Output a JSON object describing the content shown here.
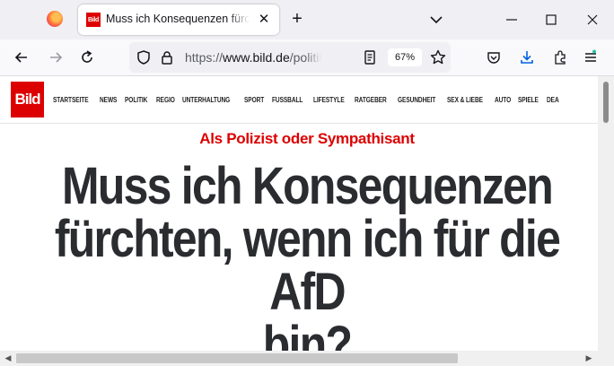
{
  "browser": {
    "tab": {
      "favicon_text": "Bild",
      "title": "Muss ich Konsequenzen fürchten, wenn ich für die AfD bin?"
    },
    "url": {
      "scheme": "https://",
      "host": "www.bild.de",
      "path": "/politik/inland/"
    },
    "zoom": "67%",
    "icons": [
      "firefox-icon",
      "new-tab-icon",
      "tabs-list-icon",
      "minimize-icon",
      "maximize-icon",
      "close-icon",
      "back-icon",
      "forward-icon",
      "reload-icon",
      "shield-icon",
      "lock-icon",
      "reader-view-icon",
      "bookmark-star-icon",
      "pocket-icon",
      "download-icon",
      "extensions-icon",
      "menu-icon"
    ]
  },
  "site": {
    "logo": "Bild",
    "brand_color": "#dd0000",
    "nav": [
      "STARTSEITE",
      "NEWS",
      "POLITIK",
      "REGIO",
      "UNTERHALTUNG",
      "SPORT",
      "FUSSBALL",
      "LIFESTYLE",
      "RATGEBER",
      "GESUNDHEIT",
      "SEX & LIEBE",
      "AUTO",
      "SPIELE",
      "DEA"
    ]
  },
  "article": {
    "kicker": "Als Polizist oder Sympathisant",
    "headline_lines": [
      "Muss ich Konsequenzen",
      "fürchten, wenn ich für die AfD",
      "bin?"
    ]
  }
}
